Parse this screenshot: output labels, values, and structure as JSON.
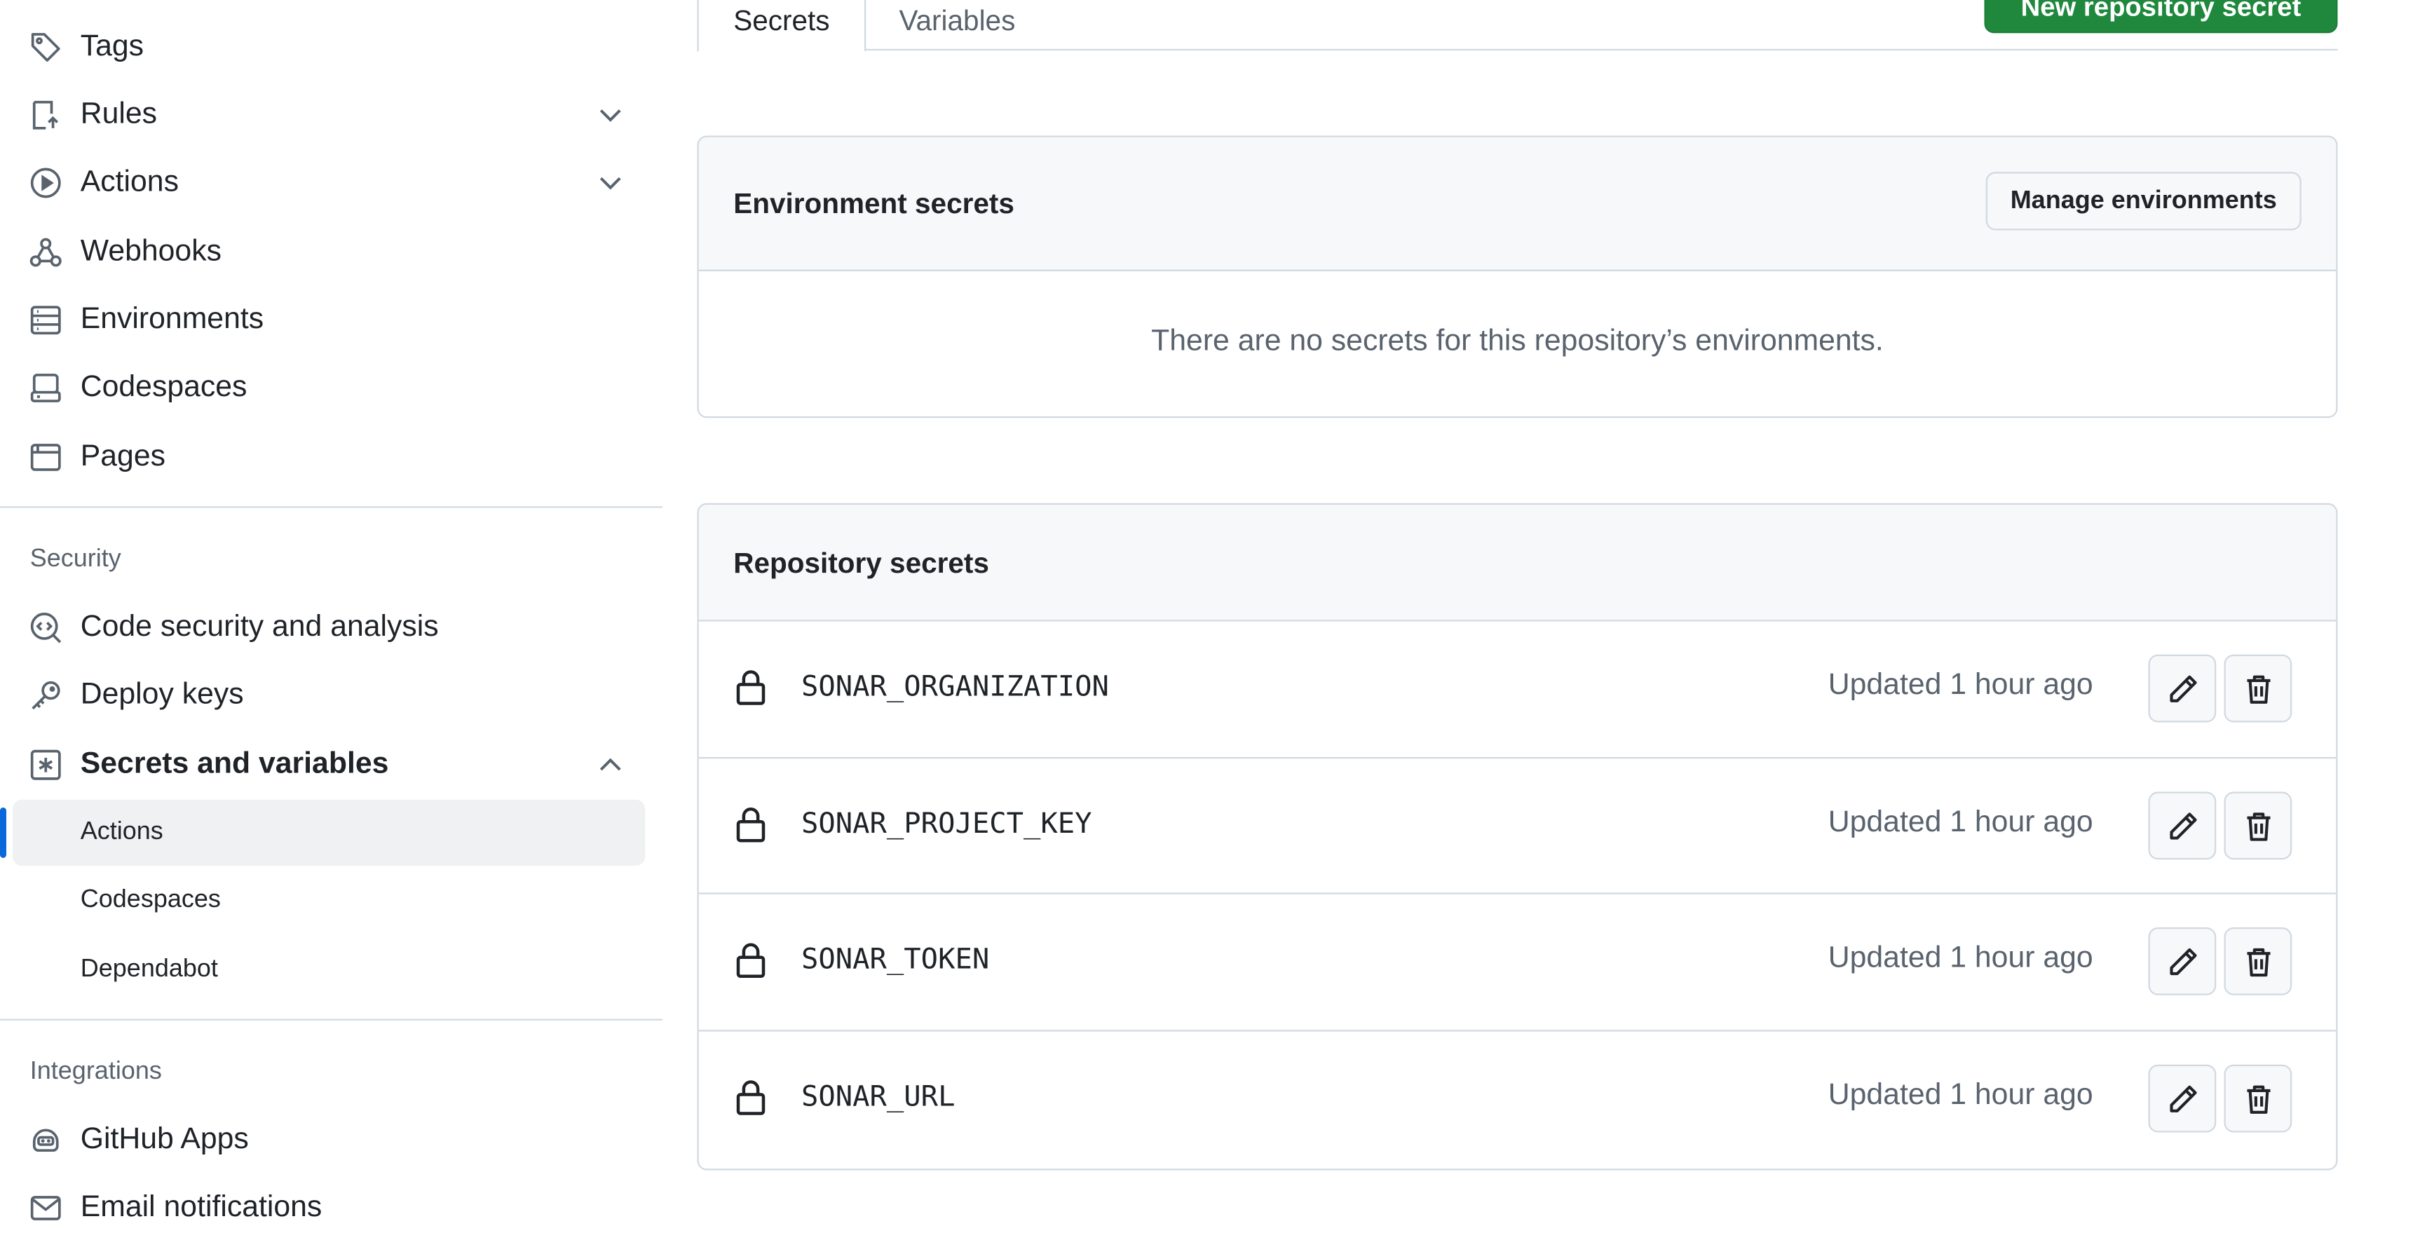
{
  "sidebar": {
    "nav_top": [
      {
        "label": "Tags",
        "icon": "tag-icon"
      },
      {
        "label": "Rules",
        "icon": "rules-icon",
        "expandable": true
      },
      {
        "label": "Actions",
        "icon": "play-icon",
        "expandable": true
      },
      {
        "label": "Webhooks",
        "icon": "webhook-icon"
      },
      {
        "label": "Environments",
        "icon": "server-icon"
      },
      {
        "label": "Codespaces",
        "icon": "codespaces-icon"
      },
      {
        "label": "Pages",
        "icon": "browser-icon"
      }
    ],
    "security_section_title": "Security",
    "security_items": [
      {
        "label": "Code security and analysis",
        "icon": "codescan-icon"
      },
      {
        "label": "Deploy keys",
        "icon": "key-icon"
      },
      {
        "label": "Secrets and variables",
        "icon": "asterisk-icon",
        "expanded": true
      }
    ],
    "secrets_subitems": [
      {
        "label": "Actions",
        "active": true
      },
      {
        "label": "Codespaces",
        "active": false
      },
      {
        "label": "Dependabot",
        "active": false
      }
    ],
    "integrations_section_title": "Integrations",
    "integrations_items": [
      {
        "label": "GitHub Apps",
        "icon": "apps-icon"
      },
      {
        "label": "Email notifications",
        "icon": "mail-icon"
      }
    ]
  },
  "tabs": {
    "secrets": "Secrets",
    "variables": "Variables"
  },
  "new_secret_button": "New repository secret",
  "environment_secrets": {
    "title": "Environment secrets",
    "manage_button": "Manage environments",
    "empty_message": "There are no secrets for this repository’s environments."
  },
  "repository_secrets": {
    "title": "Repository secrets",
    "rows": [
      {
        "name": "SONAR_ORGANIZATION",
        "updated": "Updated 1 hour ago"
      },
      {
        "name": "SONAR_PROJECT_KEY",
        "updated": "Updated 1 hour ago"
      },
      {
        "name": "SONAR_TOKEN",
        "updated": "Updated 1 hour ago"
      },
      {
        "name": "SONAR_URL",
        "updated": "Updated 1 hour ago"
      }
    ]
  },
  "colors": {
    "accent_blue": "#0969da",
    "primary_green": "#1f883d",
    "border": "#d1d9e0",
    "muted_text": "#59636e"
  }
}
